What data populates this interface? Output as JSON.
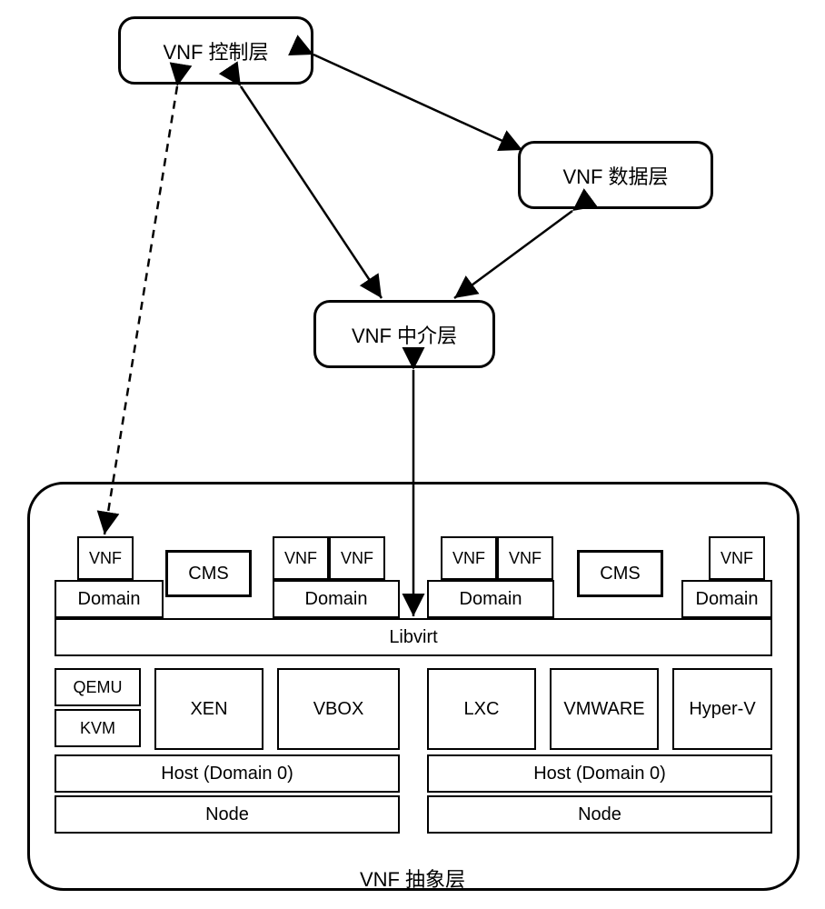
{
  "layers": {
    "control": "VNF 控制层",
    "data": "VNF 数据层",
    "mediator": "VNF 中介层",
    "abstract": "VNF 抽象层"
  },
  "abstract": {
    "libvirt": "Libvirt",
    "left": {
      "vnf": "VNF",
      "cms": "CMS",
      "domain": "Domain",
      "qemu": "QEMU",
      "kvm": "KVM",
      "xen": "XEN",
      "vbox": "VBOX",
      "host": "Host (Domain 0)",
      "node": "Node"
    },
    "right": {
      "vnf": "VNF",
      "cms": "CMS",
      "domain": "Domain",
      "lxc": "LXC",
      "vmware": "VMWARE",
      "hyperv": "Hyper-V",
      "host": "Host (Domain 0)",
      "node": "Node"
    }
  }
}
